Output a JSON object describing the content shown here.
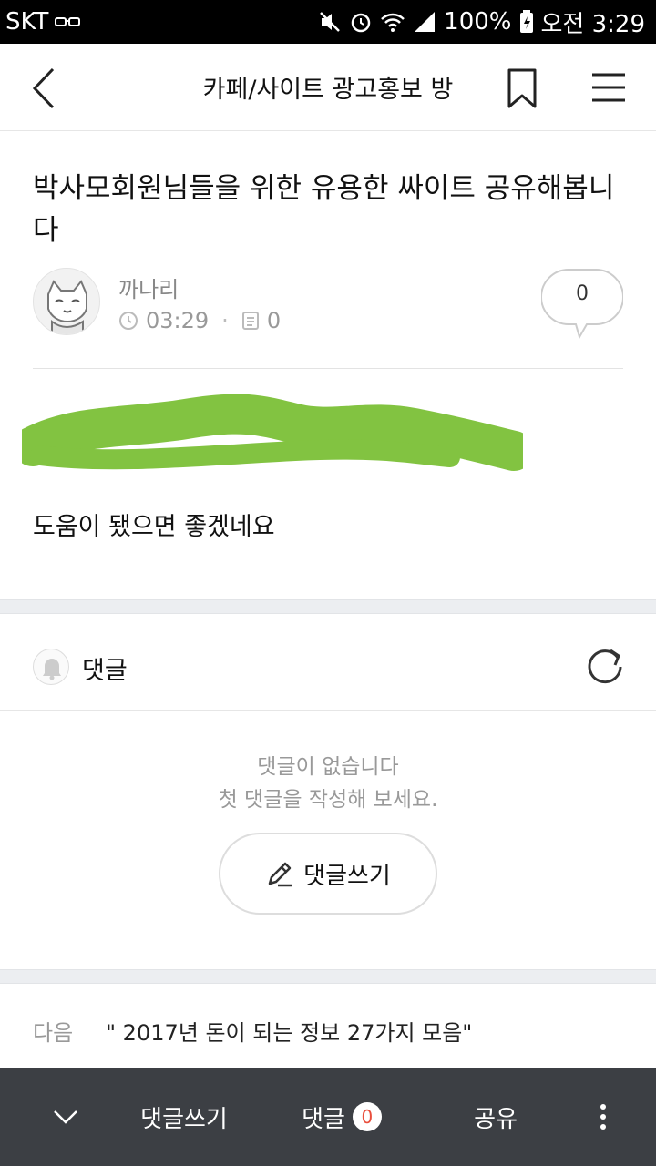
{
  "status_bar": {
    "carrier": "SKT",
    "battery": "100%",
    "time": "오전 3:29"
  },
  "header": {
    "title": "카페/사이트 광고홍보 방",
    "icons": [
      "back-icon",
      "bookmark-icon",
      "menu-icon"
    ]
  },
  "article": {
    "title": "박사모회원님들을 위한 유용한 싸이트 공유해봅니다",
    "author": "까나리",
    "time": "03:29",
    "views": "0",
    "comment_count": "0",
    "body": "도움이 됐으면 좋겠네요",
    "redaction_color": "#82c341"
  },
  "comments": {
    "label": "댓글",
    "empty_line1": "댓글이 없습니다",
    "empty_line2": "첫 댓글을 작성해 보세요.",
    "write_label": "댓글쓰기"
  },
  "next_post": {
    "label": "다음",
    "title": "\" 2017년 돈이 되는 정보 27가지 모음\""
  },
  "bottom_bar": {
    "write_label": "댓글쓰기",
    "comments_label": "댓글",
    "comments_count": "0",
    "share_label": "공유",
    "badge_color": "#e94e3c"
  }
}
